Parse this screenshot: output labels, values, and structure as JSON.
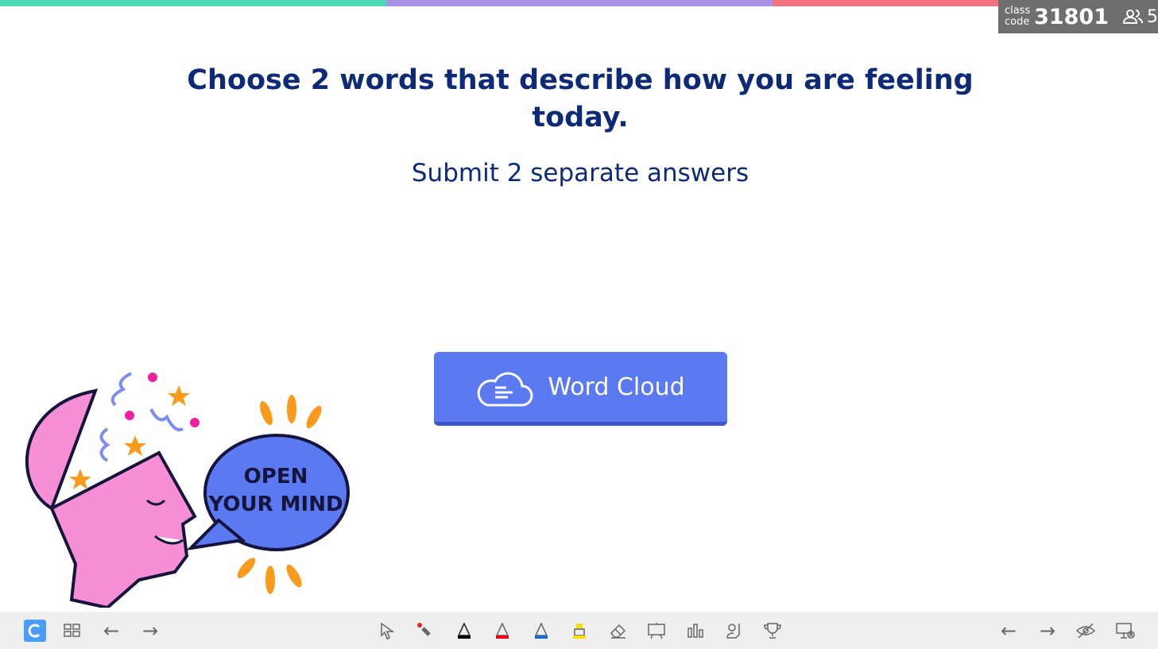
{
  "top_bar_colors": [
    "#4dd9b4",
    "#a892e8",
    "#f2727f"
  ],
  "session": {
    "class_label_1": "class",
    "class_label_2": "code",
    "class_code": "31801",
    "participants": "5"
  },
  "slide": {
    "title": "Choose 2 words that describe how you are feeling today.",
    "subtitle": "Submit 2 separate answers",
    "button_label": "Word Cloud",
    "illustration_text_1": "OPEN",
    "illustration_text_2": "YOUR MIND"
  },
  "toolbar": {
    "left": [
      "app-logo",
      "grid-icon",
      "back-arrow-icon",
      "forward-arrow-icon"
    ],
    "center": [
      "pointer-icon",
      "laser-pointer-icon",
      "black-pen-icon",
      "red-pen-icon",
      "blue-pen-icon",
      "yellow-highlighter-icon",
      "eraser-icon",
      "whiteboard-icon",
      "poll-icon",
      "student-seat-icon",
      "trophy-icon"
    ],
    "right": [
      "previous-slide-icon",
      "next-slide-icon",
      "hide-icon",
      "end-presentation-icon"
    ]
  },
  "accent": "#5b79f0"
}
